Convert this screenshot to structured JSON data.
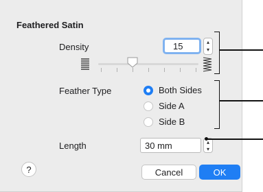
{
  "dialog": {
    "title": "Feathered Satin",
    "density": {
      "label": "Density",
      "value": "15",
      "slider_level": 0.33
    },
    "feather_type": {
      "label": "Feather Type",
      "options": [
        {
          "label": "Both Sides",
          "selected": true
        },
        {
          "label": "Side A",
          "selected": false
        },
        {
          "label": "Side B",
          "selected": false
        }
      ]
    },
    "length": {
      "label": "Length",
      "value": "30 mm"
    },
    "buttons": {
      "help": "?",
      "cancel": "Cancel",
      "ok": "OK"
    }
  },
  "icons": {
    "stepper_up": "▴",
    "stepper_down": "▾",
    "low_density": "sparse-stitch-icon",
    "high_density": "dense-stitch-icon"
  },
  "colors": {
    "accent": "#1f7ef4",
    "focus_ring": "#7fb2f0"
  }
}
